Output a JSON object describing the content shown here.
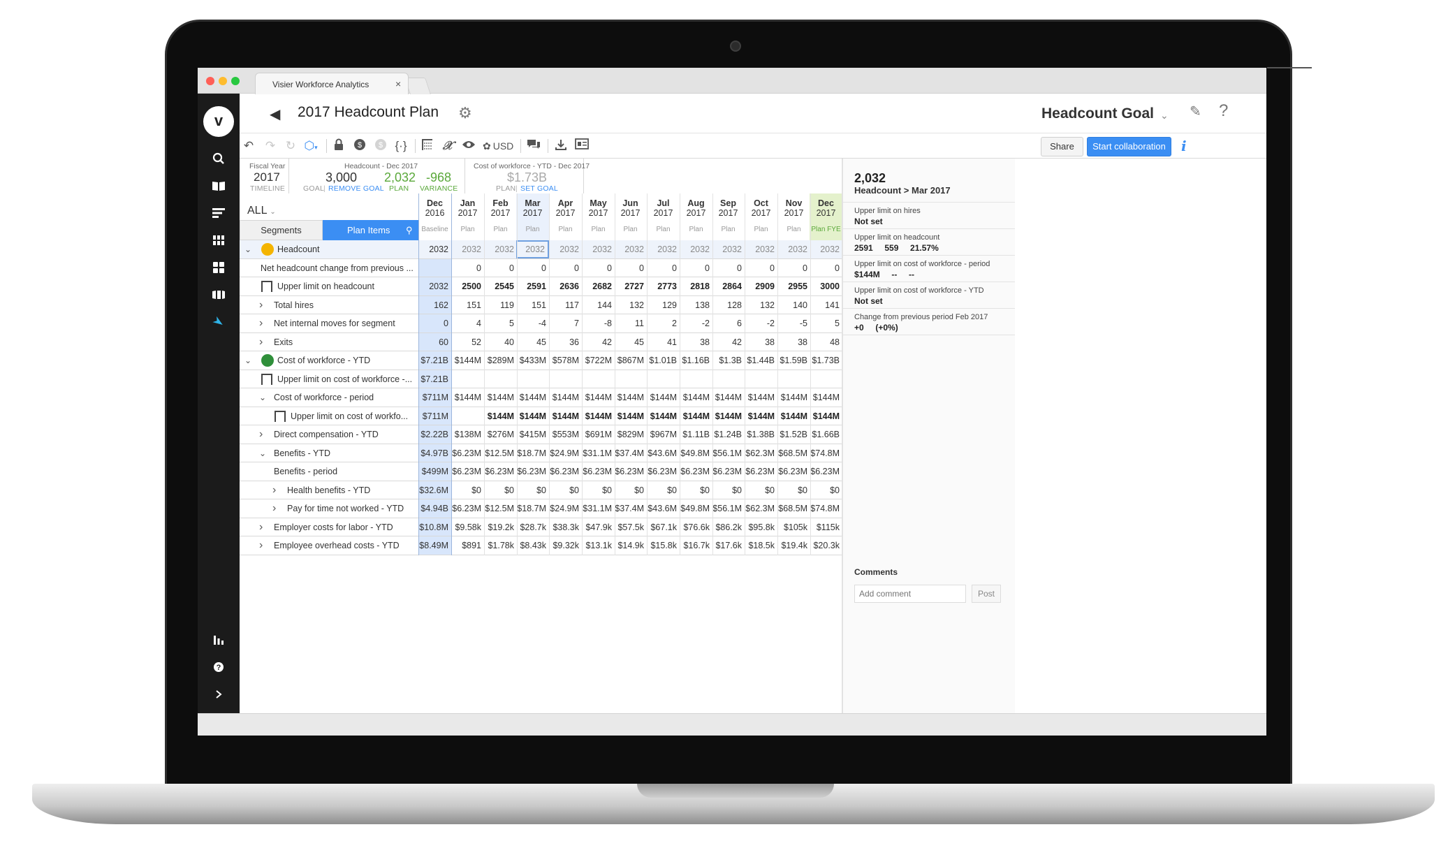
{
  "browser": {
    "tab_title": "Visier Workforce Analytics",
    "tab_close": "×"
  },
  "header": {
    "title": "2017 Headcount Plan",
    "goal_title": "Headcount Goal"
  },
  "toolbar": {
    "currency_label": "USD",
    "share_label": "Share",
    "collab_label": "Start collaboration",
    "info_label": "i"
  },
  "summary": {
    "fiscal_caption": "Fiscal Year",
    "fiscal_value": "2017",
    "fiscal_sub": "TIMELINE",
    "hc_caption": "Headcount - Dec 2017",
    "hc_goal_value": "3,000",
    "hc_goal_label": "GOAL",
    "hc_remove_goal": "REMOVE GOAL",
    "hc_plan_value": "2,032",
    "hc_plan_label": "PLAN",
    "hc_var_value": "-968",
    "hc_var_label": "VARIANCE",
    "cost_caption": "Cost of workforce - YTD - Dec 2017",
    "cost_plan_value": "$1.73B",
    "cost_plan_label": "PLAN",
    "cost_set_goal": "SET GOAL"
  },
  "grid": {
    "filter_label": "ALL",
    "segments_tab": "Segments",
    "plan_items_tab": "Plan Items",
    "columns": [
      {
        "month": "Dec",
        "year": "2016",
        "type": "Baseline"
      },
      {
        "month": "Jan",
        "year": "2017",
        "type": "Plan"
      },
      {
        "month": "Feb",
        "year": "2017",
        "type": "Plan"
      },
      {
        "month": "Mar",
        "year": "2017",
        "type": "Plan"
      },
      {
        "month": "Apr",
        "year": "2017",
        "type": "Plan"
      },
      {
        "month": "May",
        "year": "2017",
        "type": "Plan"
      },
      {
        "month": "Jun",
        "year": "2017",
        "type": "Plan"
      },
      {
        "month": "Jul",
        "year": "2017",
        "type": "Plan"
      },
      {
        "month": "Aug",
        "year": "2017",
        "type": "Plan"
      },
      {
        "month": "Sep",
        "year": "2017",
        "type": "Plan"
      },
      {
        "month": "Oct",
        "year": "2017",
        "type": "Plan"
      },
      {
        "month": "Nov",
        "year": "2017",
        "type": "Plan"
      },
      {
        "month": "Dec",
        "year": "2017",
        "type": "Plan FYE"
      }
    ],
    "rows": [
      {
        "label": "Headcount",
        "values": [
          "2032",
          "2032",
          "2032",
          "2032",
          "2032",
          "2032",
          "2032",
          "2032",
          "2032",
          "2032",
          "2032",
          "2032",
          "2032"
        ]
      },
      {
        "label": "Net headcount change from previous ...",
        "values": [
          "",
          "0",
          "0",
          "0",
          "0",
          "0",
          "0",
          "0",
          "0",
          "0",
          "0",
          "0",
          "0"
        ]
      },
      {
        "label": "Upper limit on headcount",
        "values": [
          "2032",
          "2500",
          "2545",
          "2591",
          "2636",
          "2682",
          "2727",
          "2773",
          "2818",
          "2864",
          "2909",
          "2955",
          "3000"
        ]
      },
      {
        "label": "Total hires",
        "values": [
          "162",
          "151",
          "119",
          "151",
          "117",
          "144",
          "132",
          "129",
          "138",
          "128",
          "132",
          "140",
          "141"
        ]
      },
      {
        "label": "Net internal moves for segment",
        "values": [
          "0",
          "4",
          "5",
          "-4",
          "7",
          "-8",
          "11",
          "2",
          "-2",
          "6",
          "-2",
          "-5",
          "5"
        ]
      },
      {
        "label": "Exits",
        "values": [
          "60",
          "52",
          "40",
          "45",
          "36",
          "42",
          "45",
          "41",
          "38",
          "42",
          "38",
          "38",
          "48"
        ]
      },
      {
        "label": "Cost of workforce - YTD",
        "values": [
          "$7.21B",
          "$144M",
          "$289M",
          "$433M",
          "$578M",
          "$722M",
          "$867M",
          "$1.01B",
          "$1.16B",
          "$1.3B",
          "$1.44B",
          "$1.59B",
          "$1.73B"
        ]
      },
      {
        "label": "Upper limit on cost of workforce -...",
        "values": [
          "$7.21B",
          "",
          "",
          "",
          "",
          "",
          "",
          "",
          "",
          "",
          "",
          "",
          ""
        ]
      },
      {
        "label": "Cost of workforce - period",
        "values": [
          "$711M",
          "$144M",
          "$144M",
          "$144M",
          "$144M",
          "$144M",
          "$144M",
          "$144M",
          "$144M",
          "$144M",
          "$144M",
          "$144M",
          "$144M"
        ]
      },
      {
        "label": "Upper limit on cost of workfo...",
        "values": [
          "$711M",
          "",
          "$144M",
          "$144M",
          "$144M",
          "$144M",
          "$144M",
          "$144M",
          "$144M",
          "$144M",
          "$144M",
          "$144M",
          "$144M"
        ]
      },
      {
        "label": "Direct compensation - YTD",
        "values": [
          "$2.22B",
          "$138M",
          "$276M",
          "$415M",
          "$553M",
          "$691M",
          "$829M",
          "$967M",
          "$1.11B",
          "$1.24B",
          "$1.38B",
          "$1.52B",
          "$1.66B"
        ]
      },
      {
        "label": "Benefits - YTD",
        "values": [
          "$4.97B",
          "$6.23M",
          "$12.5M",
          "$18.7M",
          "$24.9M",
          "$31.1M",
          "$37.4M",
          "$43.6M",
          "$49.8M",
          "$56.1M",
          "$62.3M",
          "$68.5M",
          "$74.8M"
        ]
      },
      {
        "label": "Benefits - period",
        "values": [
          "$499M",
          "$6.23M",
          "$6.23M",
          "$6.23M",
          "$6.23M",
          "$6.23M",
          "$6.23M",
          "$6.23M",
          "$6.23M",
          "$6.23M",
          "$6.23M",
          "$6.23M",
          "$6.23M"
        ]
      },
      {
        "label": "Health benefits - YTD",
        "values": [
          "$32.6M",
          "$0",
          "$0",
          "$0",
          "$0",
          "$0",
          "$0",
          "$0",
          "$0",
          "$0",
          "$0",
          "$0",
          "$0"
        ]
      },
      {
        "label": "Pay for time not worked - YTD",
        "values": [
          "$4.94B",
          "$6.23M",
          "$12.5M",
          "$18.7M",
          "$24.9M",
          "$31.1M",
          "$37.4M",
          "$43.6M",
          "$49.8M",
          "$56.1M",
          "$62.3M",
          "$68.5M",
          "$74.8M"
        ]
      },
      {
        "label": "Employer costs for labor - YTD",
        "values": [
          "$10.8M",
          "$9.58k",
          "$19.2k",
          "$28.7k",
          "$38.3k",
          "$47.9k",
          "$57.5k",
          "$67.1k",
          "$76.6k",
          "$86.2k",
          "$95.8k",
          "$105k",
          "$115k"
        ]
      },
      {
        "label": "Employee overhead costs - YTD",
        "values": [
          "$8.49M",
          "$891",
          "$1.78k",
          "$8.43k",
          "$9.32k",
          "$13.1k",
          "$14.9k",
          "$15.8k",
          "$16.7k",
          "$17.6k",
          "$18.5k",
          "$19.4k",
          "$20.3k"
        ]
      }
    ]
  },
  "panel": {
    "value": "2,032",
    "context": "Headcount > Mar 2017",
    "items": [
      {
        "label": "Upper limit on hires",
        "value": "Not set"
      },
      {
        "label": "Upper limit on headcount",
        "value": "2591     559     21.57%"
      },
      {
        "label": "Upper limit on cost of workforce - period",
        "value": "$144M     --     --"
      },
      {
        "label": "Upper limit on cost of workforce - YTD",
        "value": "Not set"
      },
      {
        "label": "Change from previous period Feb 2017",
        "value": "+0     (+0%)"
      }
    ],
    "comments_title": "Comments",
    "comment_placeholder": "Add comment",
    "post_label": "Post"
  },
  "colors": {
    "accent": "#3b8ef3",
    "baseline_fill": "#d8e6fb",
    "fye_fill": "#e4f1cc",
    "goal_green": "#5aa83a",
    "nav_bg": "#1b1b1b"
  }
}
